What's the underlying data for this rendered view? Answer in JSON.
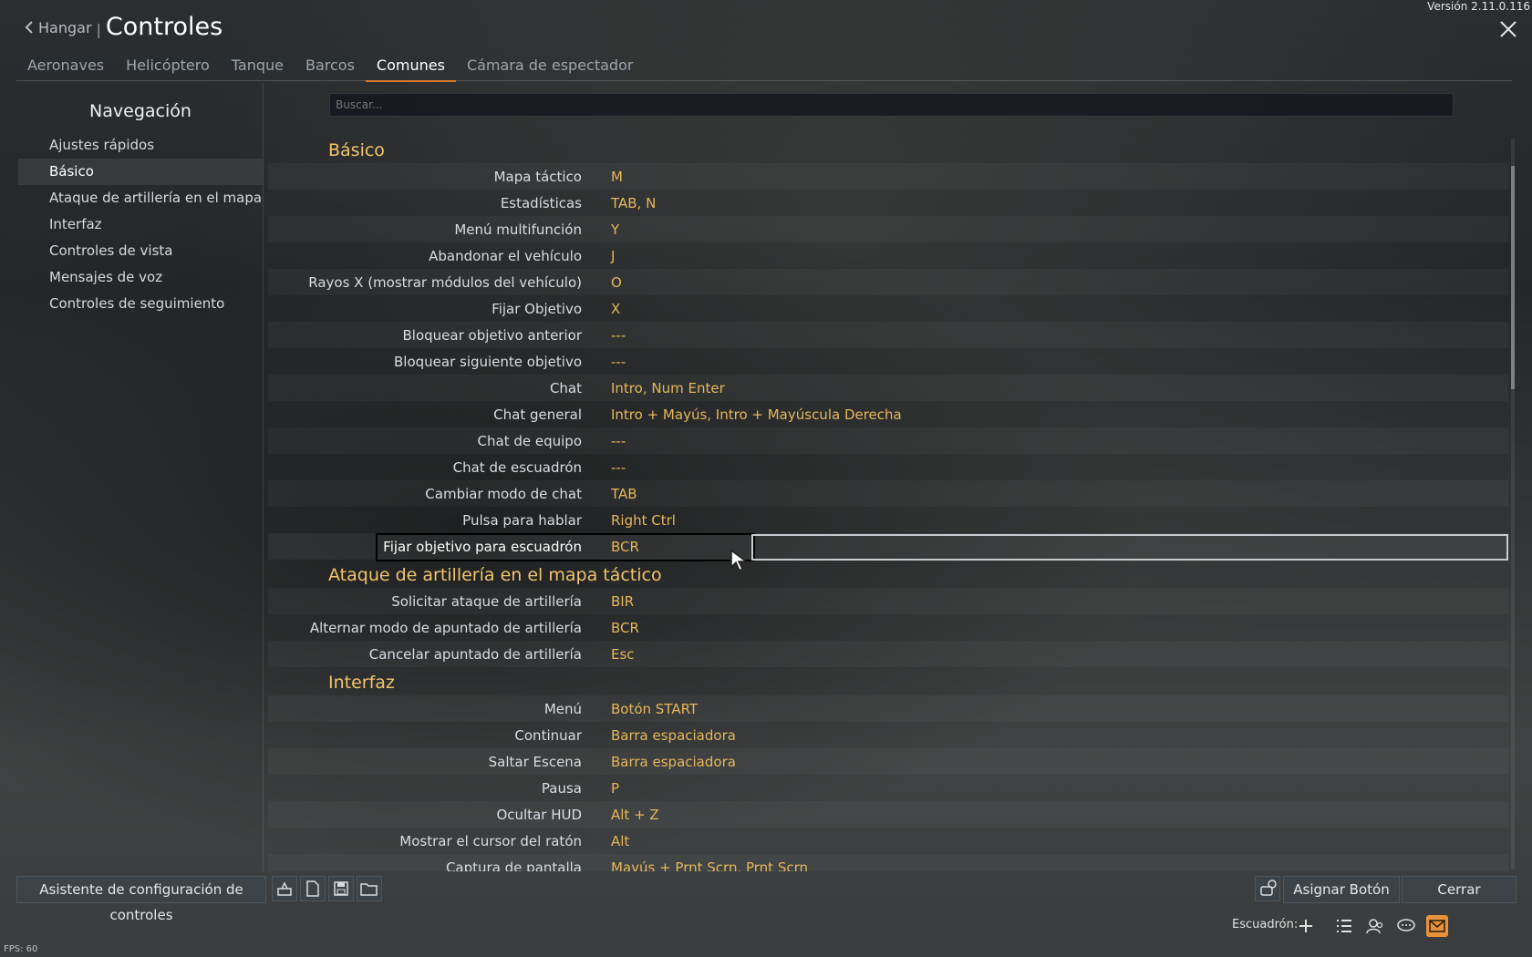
{
  "version": "Versión 2.11.0.116",
  "header": {
    "back_label": "Hangar",
    "separator": "|",
    "title": "Controles"
  },
  "tabs": [
    {
      "label": "Aeronaves"
    },
    {
      "label": "Helicóptero"
    },
    {
      "label": "Tanque"
    },
    {
      "label": "Barcos"
    },
    {
      "label": "Comunes",
      "active": true
    },
    {
      "label": "Cámara de espectador"
    }
  ],
  "nav": {
    "title": "Navegación",
    "items": [
      {
        "label": "Ajustes rápidos"
      },
      {
        "label": "Básico",
        "active": true
      },
      {
        "label": "Ataque de artillería en el mapa táctico"
      },
      {
        "label": "Interfaz"
      },
      {
        "label": "Controles de vista"
      },
      {
        "label": "Mensajes de voz"
      },
      {
        "label": "Controles de seguimiento"
      }
    ]
  },
  "search": {
    "placeholder": "Buscar..."
  },
  "sections": [
    {
      "title": "Básico",
      "rows": [
        {
          "label": "Mapa táctico",
          "value": "M"
        },
        {
          "label": "Estadísticas",
          "value": "TAB, N"
        },
        {
          "label": "Menú multifunción",
          "value": "Y"
        },
        {
          "label": "Abandonar el vehículo",
          "value": "J"
        },
        {
          "label": "Rayos X (mostrar módulos del vehículo)",
          "value": "O"
        },
        {
          "label": "Fijar Objetivo",
          "value": "X"
        },
        {
          "label": "Bloquear objetivo anterior",
          "value": "---"
        },
        {
          "label": "Bloquear siguiente objetivo",
          "value": "---"
        },
        {
          "label": "Chat",
          "value": "Intro, Num Enter"
        },
        {
          "label": "Chat general",
          "value": "Intro + Mayús, Intro + Mayúscula Derecha"
        },
        {
          "label": "Chat de equipo",
          "value": "---"
        },
        {
          "label": "Chat de escuadrón",
          "value": "---"
        },
        {
          "label": "Cambiar modo de chat",
          "value": "TAB"
        },
        {
          "label": "Pulsa para hablar",
          "value": "Right Ctrl"
        },
        {
          "label": "Fijar objetivo para escuadrón",
          "value": "BCR",
          "selected": true
        }
      ]
    },
    {
      "title": "Ataque de artillería en el mapa táctico",
      "rows": [
        {
          "label": "Solicitar ataque de artillería",
          "value": "BIR"
        },
        {
          "label": "Alternar modo de apuntado de artillería",
          "value": "BCR"
        },
        {
          "label": "Cancelar apuntado de artillería",
          "value": "Esc"
        }
      ]
    },
    {
      "title": "Interfaz",
      "rows": [
        {
          "label": "Menú",
          "value": "Botón START"
        },
        {
          "label": "Continuar",
          "value": "Barra espaciadora"
        },
        {
          "label": "Saltar Escena",
          "value": "Barra espaciadora"
        },
        {
          "label": "Pausa",
          "value": "P"
        },
        {
          "label": "Ocultar HUD",
          "value": "Alt + Z"
        },
        {
          "label": "Mostrar el cursor del ratón",
          "value": "Alt"
        },
        {
          "label": "Captura de pantalla",
          "value": "Mayús + Prnt Scrn, Prnt Scrn"
        }
      ]
    }
  ],
  "bottom": {
    "wizard_label": "Asistente de configuración de controles",
    "assign_label": "Asignar Botón",
    "close_label": "Cerrar",
    "icons": [
      "gamepad-wizard-icon",
      "new-preset-icon",
      "save-icon",
      "open-folder-icon",
      "reset-bind-icon"
    ]
  },
  "footer": {
    "squad_label": "Escuadrón:",
    "fps": "FPS: 60"
  },
  "colors": {
    "accent": "#d9772a",
    "value": "#e6b75a",
    "section": "#f3c36b"
  }
}
